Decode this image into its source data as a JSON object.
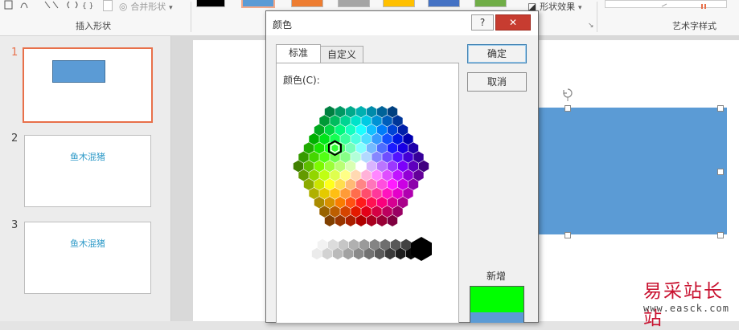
{
  "ribbon": {
    "merge_shapes_label": "合并形状",
    "insert_shapes_group": "插入形状",
    "shape_effects_label": "形状效果",
    "wordart_group": "艺术字样式",
    "swatch_colors": [
      "#000000",
      "#5b9bd5",
      "#ed7d31",
      "#a5a5a5",
      "#ffc000",
      "#4472c4",
      "#70ad47"
    ]
  },
  "thumbnails": [
    {
      "number": "1",
      "text": ""
    },
    {
      "number": "2",
      "text": "鱼木混猪"
    },
    {
      "number": "3",
      "text": "鱼木混猪"
    }
  ],
  "dialog": {
    "title": "颜色",
    "help_label": "?",
    "close_label": "✕",
    "tabs": [
      {
        "label": "标准"
      },
      {
        "label": "自定义"
      }
    ],
    "colors_label": "颜色(C):",
    "ok_label": "确定",
    "cancel_label": "取消",
    "new_label": "新增",
    "new_color": "#00ff00",
    "current_color": "#5b9bd5"
  },
  "watermark": {
    "text": "易采站长站",
    "url": "www.easck.com"
  },
  "colors": {
    "accent_orange": "#e8704a",
    "shape_blue": "#5b9bd5",
    "thumb_text": "#2e9ac8"
  }
}
